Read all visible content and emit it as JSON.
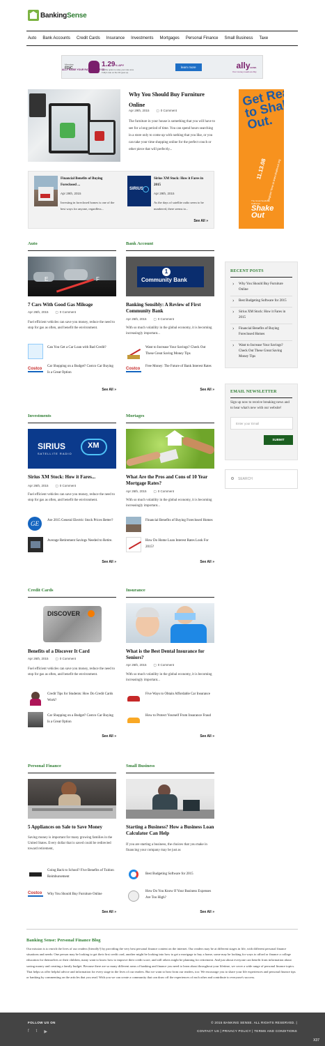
{
  "brand": {
    "name_a": "Banking",
    "name_b": "Sense"
  },
  "nav": [
    "Auto",
    "Bank Accounts",
    "Credit Cards",
    "Insurance",
    "Investments",
    "Mortgages",
    "Personal Finance",
    "Small Business",
    "Taxe"
  ],
  "banner": {
    "fdic_top": "Member",
    "fdic": "FDIC",
    "rate": "1.29",
    "rate_suffix": "% APY",
    "headline": "ALLY RAISE YOUR RATE 2-YEAR CD",
    "fine1": "Get the option to raise your rate once",
    "fine2": "if Ally's rate on the CD goes up.",
    "button": "learn more",
    "ally": "ally",
    "ally_suffix": "BANK.",
    "tagline": "Your money needs an Ally."
  },
  "featured": {
    "title": "Why You Should Buy Furniture Online",
    "date": "Apr 29th, 2015",
    "comments": "0 Comment",
    "excerpt": "The furniture in your house is something that you will have to see for a long period of time. You can spend hours searching in a store only to come up with nothing that you like, or you can take your time shopping online for the perfect couch or other piece that will perfectly..."
  },
  "minis": [
    {
      "title": "Financial Benefits of Buying Foreclosed ...",
      "date": "Apr 29th, 2015",
      "excerpt": "Investing in foreclosed homes is one of the best ways for anyone, regardless..."
    },
    {
      "title": "Sirius XM Stock: How it Fares in 2015",
      "date": "Apr 29th, 2015",
      "excerpt": "As the days of satellite radio seem to be numbered, there seems to..."
    }
  ],
  "see_all": "See All",
  "side_ad": {
    "big": "Get Ready to Shake Out.",
    "date": "11.13.08",
    "reg": "Register Now at www.shakeout.org",
    "top": "The Great Southern California",
    "bottom": "Shake Out"
  },
  "recent": {
    "heading": "RECENT POSTS",
    "items": [
      "Why You Should Buy Furniture Online",
      "Best Budgeting Software for 2015",
      "Sirius XM Stock: How it Fares in 2015",
      "Financial Benefits of Buying Foreclosed Homes",
      "Want to Increase Your Savings? Check Out These Great Saving Money Tips"
    ]
  },
  "newsletter": {
    "heading": "EMAIL NEWSLETTER",
    "text": "Sign up now to receive breaking news and to hear what's new with our website!",
    "placeholder": "Enter your Email",
    "button": "SUBMIT"
  },
  "search": {
    "placeholder": "SEARCH"
  },
  "categories": [
    {
      "heading": "Auto",
      "title": "7 Cars With Good Gas Mileage",
      "date": "Apr 26th, 2015",
      "comments": "0 Comment",
      "excerpt": "Fuel efficient vehicles can save you money, reduce the need to stop for gas as often, and benefit the environment.",
      "subs": [
        "Can You Get a Car Loan with Bad Credit?",
        "Car Shopping on a Budget? Costco Car Buying Is a Great Option"
      ]
    },
    {
      "heading": "Bank Account",
      "title": "Banking Sensibly: A Review of First Community Bank",
      "date": "Apr 26th, 2015",
      "comments": "0 Comment",
      "excerpt": "With so much volatility in the global economy, it is becoming increasingly important...",
      "image_text": "Community Bank",
      "subs": [
        "Want to Increase Your Savings? Check Out These Great Saving Money Tips",
        "Free Money: The Future of Bank Interest Rates"
      ]
    },
    {
      "heading": "Investments",
      "title": "Sirius XM Stock: How it Fares...",
      "date": "Apr 26th, 2015",
      "comments": "0 Comment",
      "excerpt": "Fuel efficient vehicles can save you money, reduce the need to stop for gas as often, and benefit the environment.",
      "image_text": "SIRIUS",
      "image_sub": "SATELLITE RADIO",
      "subs": [
        "Are 2015 General Electric Stock Prices Better?",
        "Average Retirement Savings Needed to Retire."
      ]
    },
    {
      "heading": "Mortages",
      "title": "What Are the Pros and Cons of 10 Year Mortgage Rates?",
      "date": "Apr 26th, 2015",
      "comments": "0 Comment",
      "excerpt": "With so much volatility in the global economy, it is becoming increasingly important...",
      "subs": [
        "Financial Benefits of Buying Foreclosed Homes",
        "How Do Home Loan Interest Rates Look For 2015?"
      ]
    },
    {
      "heading": "Credit Cards",
      "title": "Benefits of a Discover It Card",
      "date": "Apr 26th, 2015",
      "comments": "0 Comment",
      "excerpt": "Fuel efficient vehicles can save you money, reduce the need to stop for gas as often, and benefit the environment.",
      "image_text": "DISCOVER",
      "subs": [
        "Credit Tips for Students: How Do Credit Cards Work?",
        "Car Shopping on a Budget? Costco Car Buying Is a Great Option"
      ]
    },
    {
      "heading": "Insurance",
      "title": "What is the Best Dental Insurance for Seniors?",
      "date": "Apr 26th, 2015",
      "comments": "0 Comment",
      "excerpt": "With so much volatility in the global economy, it is becoming increasingly important...",
      "subs": [
        "Five Ways to Obtain Affordable Car Insurance",
        "How to Protect Yourself From Insurance Fraud"
      ]
    },
    {
      "heading": "Personal Finance",
      "title": "5 Appliances on Sale to Save Money",
      "date": "",
      "comments": "",
      "excerpt": "Saving money is important for many growing families in the United States. Every dollar that is saved could be redirected toward retirement,",
      "subs": [
        "Going Back to School? Five Benefits of Tuition Reimbursement",
        "Why You Should Buy Furniture Online"
      ]
    },
    {
      "heading": "Small Business",
      "title": "Starting a Business? How a Business Loan Calculator Can Help",
      "date": "",
      "comments": "",
      "excerpt": "If you are starting a business, the choices that you make in financing your company may be just as",
      "subs": [
        "Best Budgeting Software for 2015",
        "How Do You Know If Your Business Expenses Are Too High?"
      ]
    }
  ],
  "about": {
    "heading": "Banking Sense: Personal Finance Blog",
    "text": "Our mission is to enrich the lives of our readers (literally!) by providing the very best personal finance content on the internet. Our readers may be at different stages in life, with different personal finance situations and needs: One person may be looking to get their first credit card, another might be looking into how to get a mortgage to buy a home, some may be looking for ways to afford or finance a college education for themselves or their children, many want to know how to improve their credit score, and still others might be planning for retirement. And just about everyone can benefit from information about saving money and creating a family budget. Because there are so many different areas of banking and finance you need to learn about throughout your lifetime, we cover a wide range of personal finance topics. That helps us offer helpful advice and information for every stage in the lives of our readers. But we want to hear from our readers, too: We encourage you to share your life experiences and personal finance tips or banking by commenting on the articles that you read. With you we can create a community that can draw off the experiences of each other and contribute to everyone's success."
  },
  "footer": {
    "follow": "FOLLOW US ON",
    "social": [
      "f",
      "t",
      "▶"
    ],
    "copyright": "© 2015 BANKING SENSE. ALL RIGHTS RESERVED. |",
    "links": [
      "CONTACT US",
      "PRIVACY POLICY",
      "TERMS AND CONDITIONS"
    ],
    "x": "X37"
  },
  "colors": {
    "accent_green": "#2e7d32",
    "button_green": "#1b5e20",
    "footer_bg": "#444444",
    "ad_orange": "#f7921e"
  }
}
